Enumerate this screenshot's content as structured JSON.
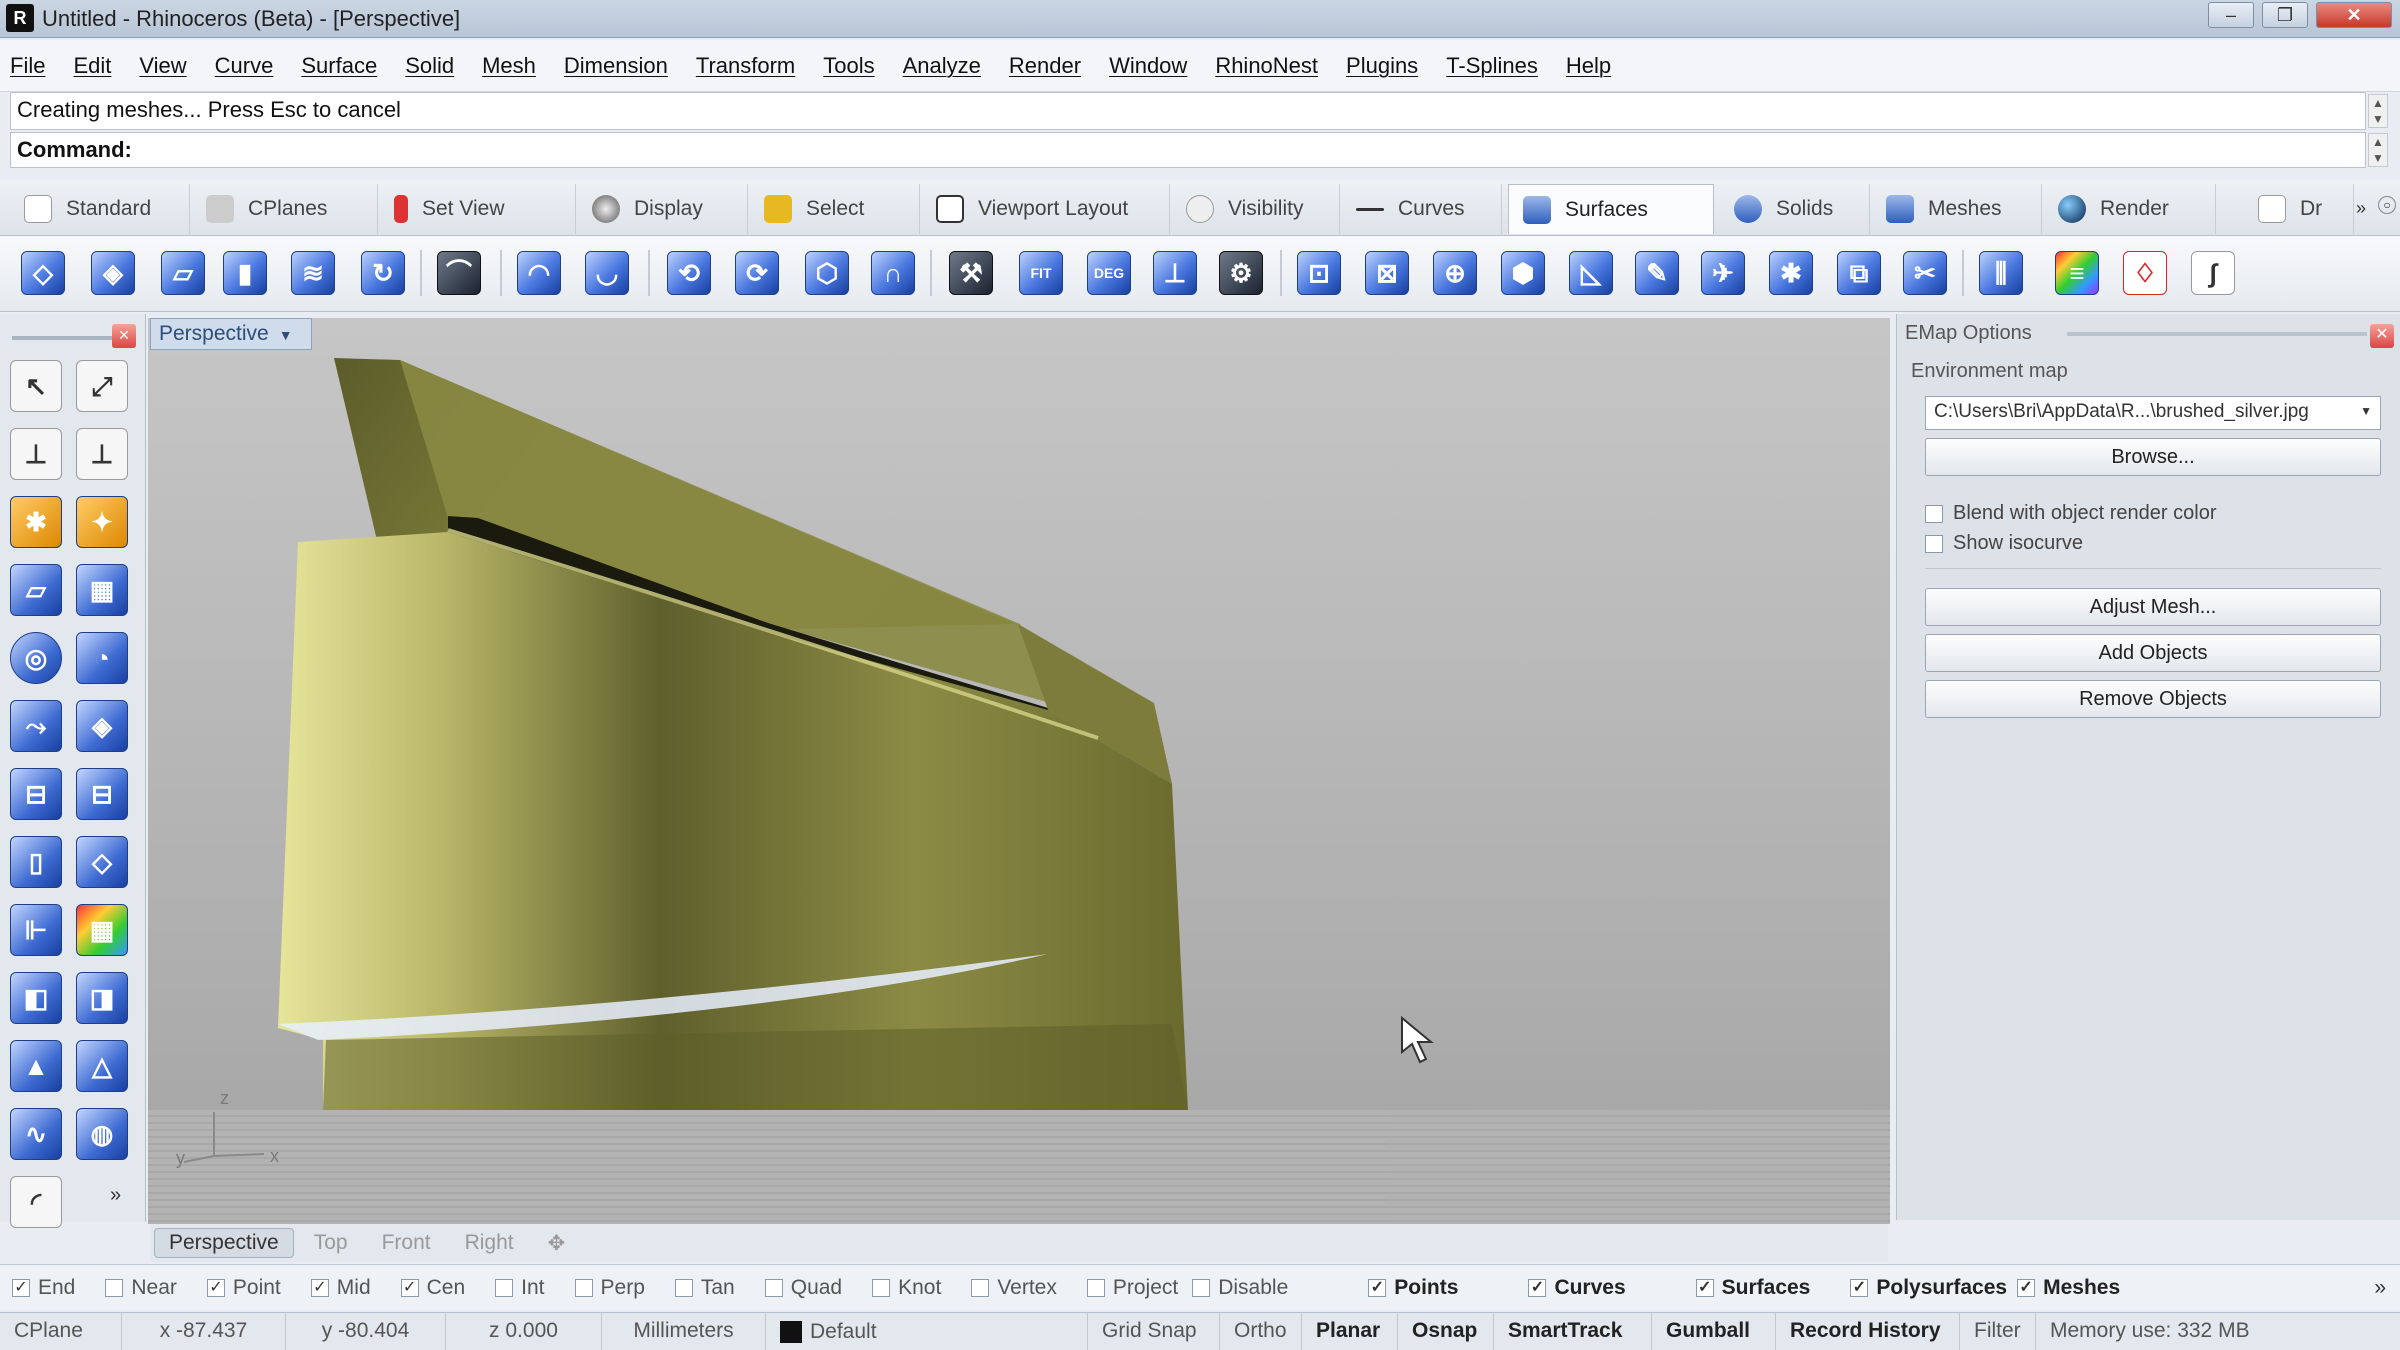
{
  "window": {
    "title": "Untitled - Rhinoceros (Beta) - [Perspective]"
  },
  "menu": [
    "File",
    "Edit",
    "View",
    "Curve",
    "Surface",
    "Solid",
    "Mesh",
    "Dimension",
    "Transform",
    "Tools",
    "Analyze",
    "Render",
    "Window",
    "RhinoNest",
    "Plugins",
    "T-Splines",
    "Help"
  ],
  "command": {
    "history": "Creating meshes... Press Esc to cancel",
    "prompt": "Command:"
  },
  "tabs": [
    "Standard",
    "CPlanes",
    "Set View",
    "Display",
    "Select",
    "Viewport Layout",
    "Visibility",
    "Curves",
    "Surfaces",
    "Solids",
    "Meshes",
    "Render",
    "Dr"
  ],
  "active_tab": "Surfaces",
  "toolbar_labels": {
    "fit": "FIT",
    "deg": "DEG"
  },
  "viewport": {
    "name": "Perspective",
    "axes": {
      "x": "x",
      "y": "y",
      "z": "z"
    },
    "tabs": [
      "Perspective",
      "Top",
      "Front",
      "Right"
    ]
  },
  "panel": {
    "title": "EMap Options",
    "env_label": "Environment map",
    "env_value": "C:\\Users\\Bri\\AppData\\R...\\brushed_silver.jpg",
    "browse": "Browse...",
    "blend": "Blend with object render color",
    "isocurve": "Show isocurve",
    "adjust": "Adjust Mesh...",
    "add": "Add Objects",
    "remove": "Remove Objects"
  },
  "osnaps": [
    {
      "label": "End",
      "on": true
    },
    {
      "label": "Near",
      "on": false
    },
    {
      "label": "Point",
      "on": true
    },
    {
      "label": "Mid",
      "on": true
    },
    {
      "label": "Cen",
      "on": true
    },
    {
      "label": "Int",
      "on": false
    },
    {
      "label": "Perp",
      "on": false
    },
    {
      "label": "Tan",
      "on": false
    },
    {
      "label": "Quad",
      "on": false
    },
    {
      "label": "Knot",
      "on": false
    },
    {
      "label": "Vertex",
      "on": false
    },
    {
      "label": "Project",
      "on": false
    },
    {
      "label": "Disable",
      "on": false
    }
  ],
  "filters": [
    "Points",
    "Curves",
    "Surfaces",
    "Polysurfaces",
    "Meshes"
  ],
  "status": {
    "cplane": "CPlane",
    "x": "x -87.437",
    "y": "y -80.404",
    "z": "z 0.000",
    "units": "Millimeters",
    "layer": "Default",
    "grid_snap": "Grid Snap",
    "ortho": "Ortho",
    "planar": "Planar",
    "osnap": "Osnap",
    "smarttrack": "SmartTrack",
    "gumball": "Gumball",
    "record": "Record History",
    "filter": "Filter",
    "memory": "Memory use: 332 MB"
  }
}
